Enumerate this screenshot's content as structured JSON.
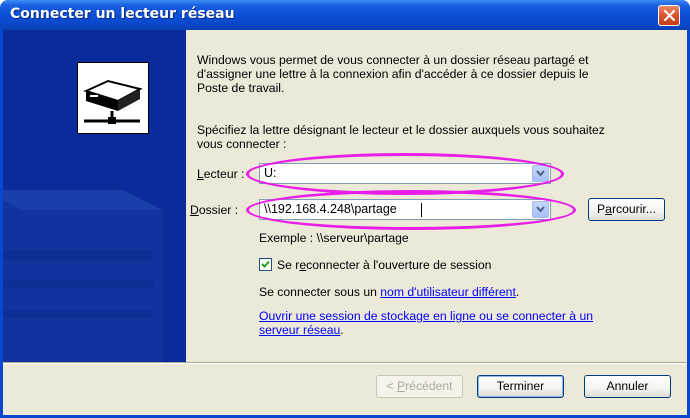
{
  "window": {
    "title": "Connecter un lecteur réseau"
  },
  "intro": {
    "lines": [
      "Windows vous permet de vous connecter à un dossier réseau partagé et",
      "d'assigner une lettre à la connexion afin d'accéder à ce dossier depuis le",
      "Poste de travail."
    ]
  },
  "instruction": {
    "lines": [
      "Spécifiez la lettre désignant le lecteur et le dossier auxquels vous souhaitez",
      "vous connecter :"
    ]
  },
  "drive": {
    "label_accel": "L",
    "label_rest": "ecteur :",
    "value": "U:"
  },
  "folder": {
    "label_accel": "D",
    "label_rest": "ossier :",
    "value": "\\\\192.168.4.248\\partage"
  },
  "browse_button": {
    "label_pre": "P",
    "label_accel": "a",
    "label_post": "rcourir..."
  },
  "example": "Exemple : \\\\serveur\\partage",
  "reconnect": {
    "checked": true,
    "label_pre": "Se r",
    "label_accel": "e",
    "label_post": "connecter à l'ouverture de session"
  },
  "different_user": {
    "prefix": "Se connecter sous un ",
    "link": "nom d'utilisateur différent",
    "suffix": "."
  },
  "online_storage": {
    "line1": "Ouvrir une session de stockage en ligne ou se connecter à un",
    "line2": "serveur réseau",
    "suffix": "."
  },
  "buttons": {
    "previous_pre": "< ",
    "previous_accel": "P",
    "previous_post": "récédent",
    "finish": "Terminer",
    "cancel": "Annuler"
  },
  "colors": {
    "annotation": "#e81ee8",
    "title_bar": "#0a47c8",
    "banner": "#0a2c9a"
  }
}
